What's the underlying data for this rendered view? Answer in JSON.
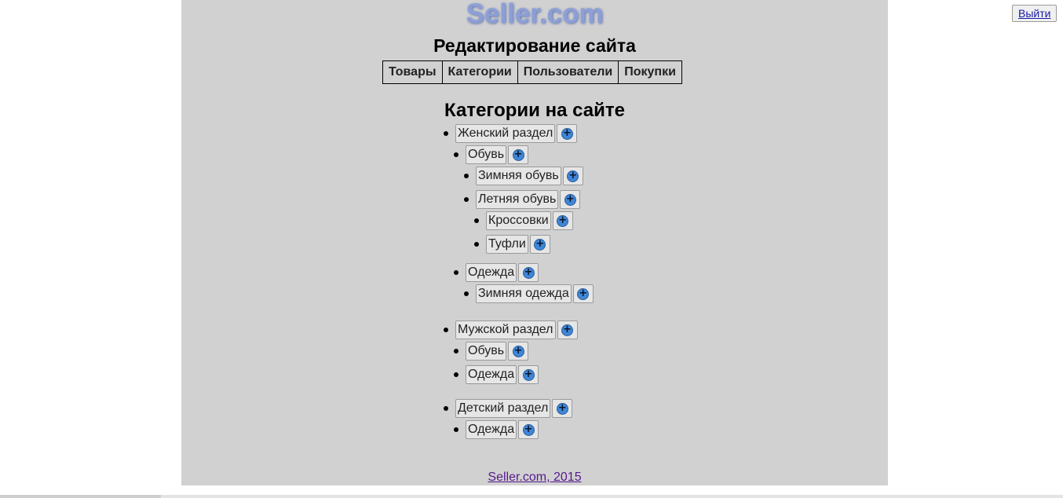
{
  "header": {
    "logo": "Seller.com",
    "title": "Редактирование сайта",
    "logout_label": "Выйти"
  },
  "nav": {
    "tabs": [
      {
        "label": "Товары"
      },
      {
        "label": "Категории"
      },
      {
        "label": "Пользователи"
      },
      {
        "label": "Покупки"
      }
    ]
  },
  "main": {
    "title": "Категории на сайте",
    "categories": [
      {
        "label": "Женский раздел",
        "level": 0
      },
      {
        "label": "Обувь",
        "level": 1
      },
      {
        "label": "Зимняя обувь",
        "level": 2
      },
      {
        "label": "Летняя обувь",
        "level": 2
      },
      {
        "label": "Кроссовки",
        "level": 3
      },
      {
        "label": "Туфли",
        "level": 3
      },
      {
        "label": "Одежда",
        "level": 1
      },
      {
        "label": "Зимняя одежда",
        "level": 2
      },
      {
        "label": "Мужской раздел",
        "level": 0
      },
      {
        "label": "Обувь",
        "level": 1
      },
      {
        "label": "Одежда",
        "level": 1
      },
      {
        "label": "Детский раздел",
        "level": 0
      },
      {
        "label": "Одежда",
        "level": 1
      }
    ],
    "add_icon": "plus-circle-icon"
  },
  "footer": {
    "link_text": "Seller.com, 2015"
  },
  "colors": {
    "page_bg": "#d1d1d1",
    "logo": "#8c9fd6",
    "add_icon": "#3f86d6",
    "footer_link": "#551a8b"
  }
}
